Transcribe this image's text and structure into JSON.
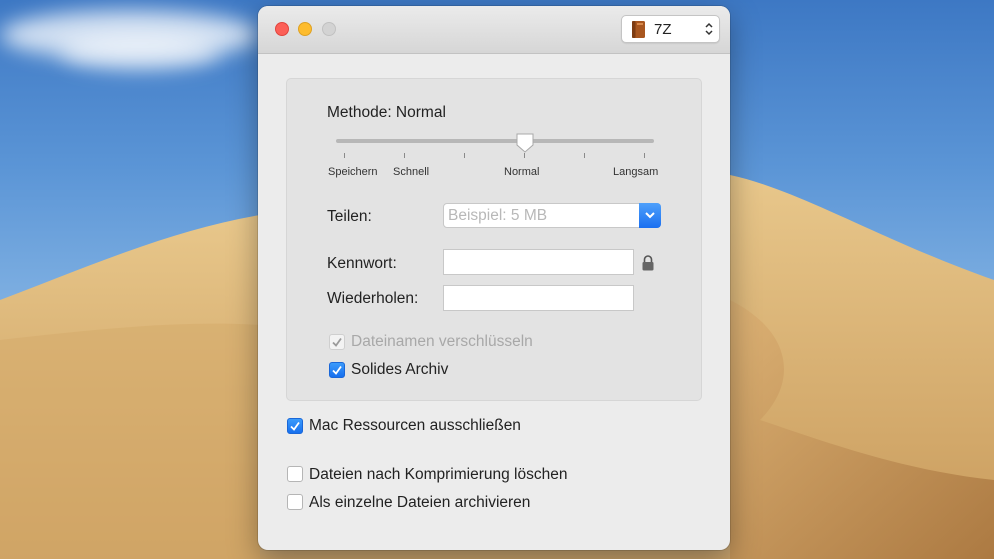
{
  "window": {
    "format_select": {
      "value": "7Z",
      "icon": "archive-book-icon"
    }
  },
  "compression": {
    "method_label": "Methode: Normal",
    "slider": {
      "level_index": 3,
      "level_count": 6,
      "tick_labels": [
        "Speichern",
        "Schnell",
        "Normal",
        "Langsam"
      ]
    }
  },
  "split": {
    "label": "Teilen:",
    "placeholder": "Beispiel: 5 MB"
  },
  "password": {
    "label": "Kennwort:",
    "value": "",
    "repeat_label": "Wiederholen:",
    "repeat_value": ""
  },
  "options": {
    "encrypt_filenames": {
      "label": "Dateinamen verschlüsseln",
      "checked": true,
      "disabled": true
    },
    "solid_archive": {
      "label": "Solides Archiv",
      "checked": true
    },
    "exclude_mac_resources": {
      "label": "Mac Ressourcen ausschließen",
      "checked": true
    },
    "delete_after": {
      "label": "Dateien nach Komprimierung löschen",
      "checked": false
    },
    "archive_separately": {
      "label": "Als einzelne Dateien archivieren",
      "checked": false
    }
  },
  "colors": {
    "accent": "#1a6ff0",
    "close": "#fc5f57",
    "minimize": "#fdbc2e",
    "zoom_disabled": "#d3d3d3"
  }
}
